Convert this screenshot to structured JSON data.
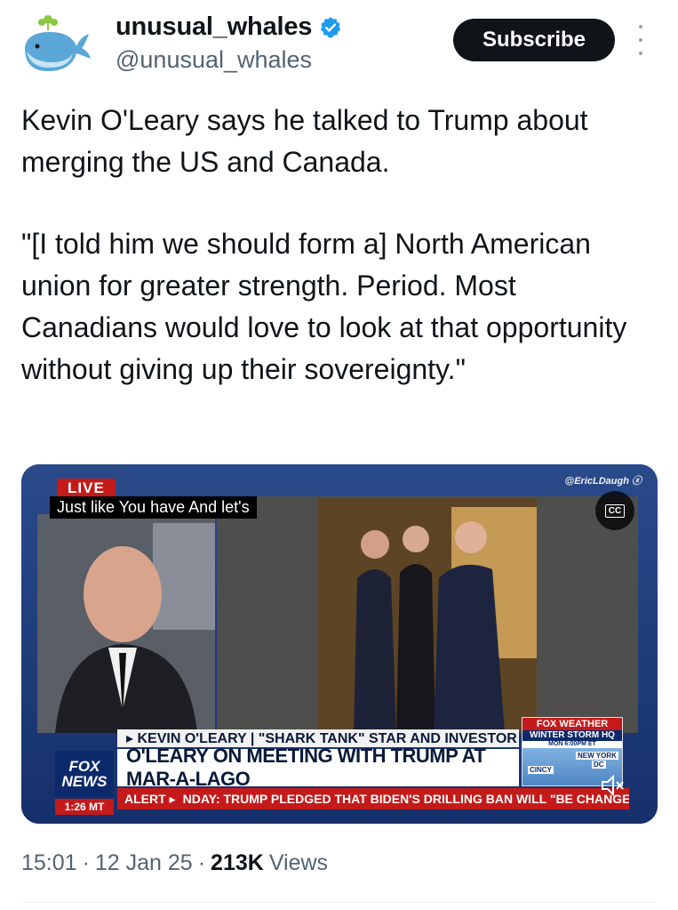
{
  "author": {
    "display_name": "unusual_whales",
    "handle": "@unusual_whales",
    "verified": true,
    "avatar_icon": "whale-avatar-icon"
  },
  "actions": {
    "subscribe_label": "Subscribe",
    "more_icon": "more-vertical-icon"
  },
  "tweet": {
    "paragraphs": [
      "Kevin O'Leary says he talked to Trump about merging the US and Canada.",
      "\"[I told him we should form a] North American union for greater strength. Period. Most Canadians would love to look at that opportunity without giving up their sovereignty.\""
    ]
  },
  "media": {
    "live_label": "LIVE",
    "caption": "Just like You have And let's",
    "watermark": "@EricLDaugh",
    "cc_label": "CC",
    "name_strap": "▸ KEVIN O'LEARY | \"SHARK TANK\" STAR AND INVESTOR",
    "headline": "O'LEARY ON MEETING WITH TRUMP AT MAR-A-LAGO",
    "network_line1": "FOX",
    "network_line2": "NEWS",
    "time": "1:26 MT",
    "alert_label": "ALERT ▸",
    "alert_text": "NDAY: TRUMP PLEDGED THAT BIDEN'S DRILLING BAN WILL \"BE CHANGED ON DA",
    "weather_brand": "FOX WEATHER",
    "weather_title": "WINTER STORM HQ",
    "weather_time": "MON 6:00PM ET",
    "weather_city1": "NEW YORK",
    "weather_city2": "DC",
    "weather_city3": "CINCY",
    "mute_icon": "muted-speaker-icon"
  },
  "meta": {
    "time": "15:01",
    "date": "12 Jan 25",
    "views_count": "213K",
    "views_label": "Views"
  },
  "colors": {
    "verified_blue": "#1d9bf0",
    "text_primary": "#0f1419",
    "text_secondary": "#536471",
    "fox_red": "#c41a1a",
    "fox_navy": "#0c2a6b"
  }
}
